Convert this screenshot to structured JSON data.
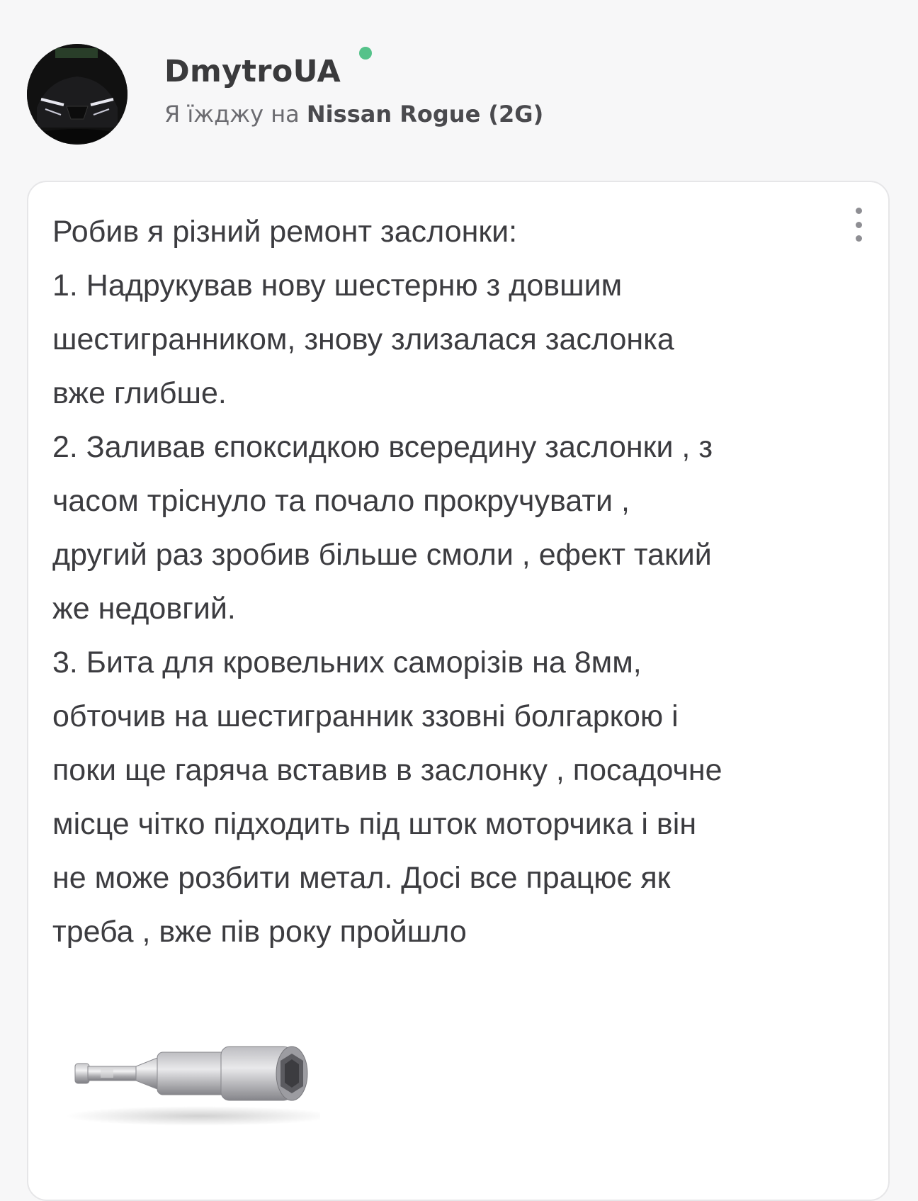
{
  "author": {
    "name": "DmytroUA",
    "online": true,
    "car_prefix": "Я їжджу на ",
    "car_name": "Nissan Rogue (2G)"
  },
  "post": {
    "lines": [
      "Робив я різний ремонт заслонки:",
      "1. Надрукував нову шестерню з довшим",
      "шестигранником, знову злизалася заслонка",
      "вже глибше.",
      "2. Заливав єпоксидкою всередину заслонки , з",
      "часом тріснуло та почало прокручувати ,",
      "другий раз зробив більше смоли , ефект такий",
      "же недовгий.",
      "3. Бита для кровельних саморізів на 8мм,",
      "обточив на шестигранник ззовні болгаркою і",
      "поки ще гаряча вставив в заслонку , посадочне",
      "місце чітко підходить під шток моторчика і він",
      "не може розбити метал. Досі все працює як",
      "треба , вже пів року пройшло"
    ]
  },
  "colors": {
    "online_dot": "#55c28a",
    "text": "#3c3c40",
    "muted": "#6b6b70"
  },
  "icons": {
    "more": "more-vertical-icon"
  }
}
